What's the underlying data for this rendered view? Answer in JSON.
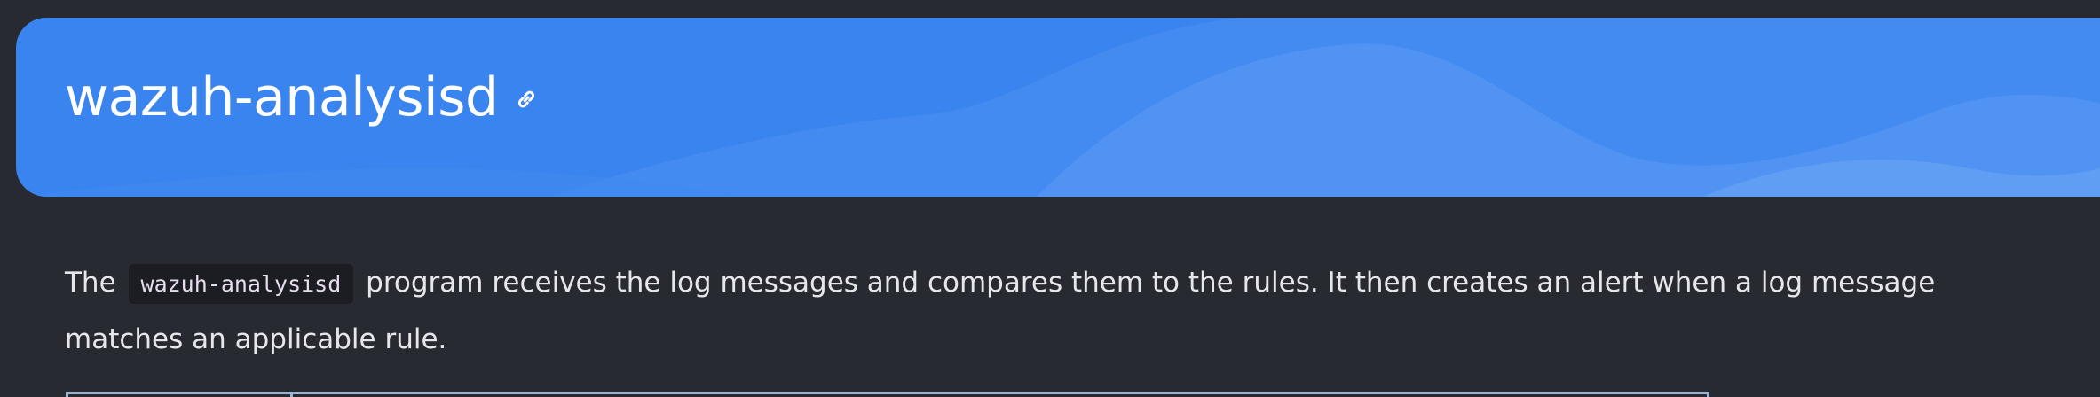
{
  "banner": {
    "title": "wazuh-analysisd",
    "anchor_icon": "link-icon",
    "color": "#3a84ef"
  },
  "paragraph": {
    "before": "The ",
    "code": "wazuh-analysisd",
    "after": " program receives the log messages and compares them to the rules. It then creates an alert when a log message matches an applicable rule."
  },
  "colors": {
    "background": "#282a31",
    "text": "#e6e7ea",
    "code_background": "#1c1d22",
    "table_border": "#9fb3cf"
  }
}
